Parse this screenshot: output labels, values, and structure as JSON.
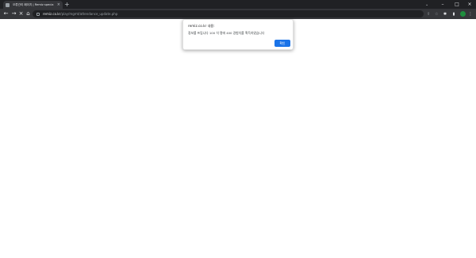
{
  "tab": {
    "title": "오류관리 페이지 | Remiz specia",
    "close": "×",
    "new_tab": "+"
  },
  "window": {
    "minimize": "–",
    "maximize": "□",
    "close": "×",
    "tab_search": "⌄"
  },
  "nav": {
    "back": "←",
    "forward": "→",
    "stop": "×",
    "home": "⌂"
  },
  "address": {
    "host": "remiz.co.kr",
    "path": "/play/mgmt/attendance_update.php",
    "share_icon": "⇪",
    "bookmark_icon": "☆"
  },
  "toolbar": {
    "extensions_icon": "✱",
    "sidebar_icon": "▮",
    "avatar_letter": "",
    "menu_icon": "⋮"
  },
  "dialog": {
    "title": "remiz.co.kr 내용:",
    "message": "정보를 프립니다 100 석 명에 400 경험치를 획득하였습니다",
    "ok_label": "확인"
  }
}
